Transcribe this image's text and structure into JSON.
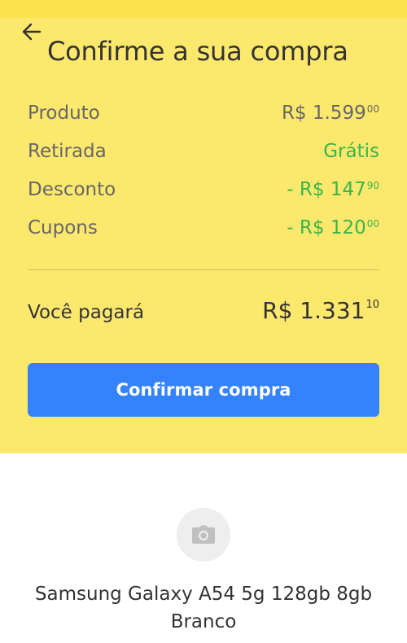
{
  "header": {
    "title": "Confirme a sua compra"
  },
  "summary": {
    "rows": [
      {
        "label": "Produto",
        "value_main": "R$ 1.599",
        "value_cents": "00",
        "color": "#666666"
      },
      {
        "label": "Retirada",
        "value_main": "Grátis",
        "value_cents": "",
        "color": "#39b54a"
      },
      {
        "label": "Desconto",
        "value_main": "- R$ 147",
        "value_cents": "90",
        "color": "#39b54a"
      },
      {
        "label": "Cupons",
        "value_main": "- R$ 120",
        "value_cents": "00",
        "color": "#39b54a"
      }
    ],
    "total": {
      "label": "Você pagará",
      "value_main": "R$ 1.331",
      "value_cents": "10"
    }
  },
  "actions": {
    "confirm_label": "Confirmar compra"
  },
  "product": {
    "image_icon": "camera-icon",
    "name": "Samsung Galaxy A54 5g 128gb 8gb Branco"
  },
  "colors": {
    "header_bg": "#fde86e",
    "accent_blue": "#3483fa",
    "discount_green": "#39b54a"
  }
}
